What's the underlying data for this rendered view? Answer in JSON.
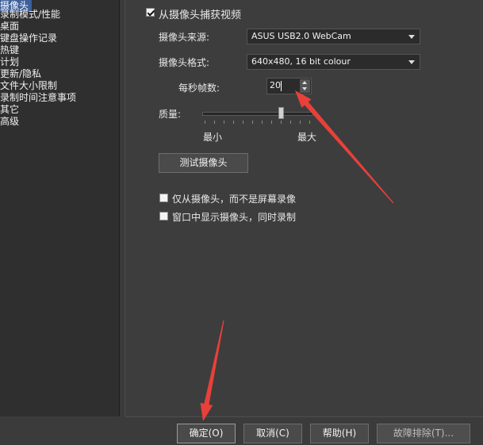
{
  "sidebar": {
    "items": [
      {
        "label": "摄像头",
        "selected": true
      },
      {
        "label": "录制模式/性能"
      },
      {
        "label": "桌面"
      },
      {
        "label": "键盘操作记录"
      },
      {
        "label": "热键"
      },
      {
        "label": "计划"
      },
      {
        "label": "更新/隐私"
      },
      {
        "label": "文件大小限制"
      },
      {
        "label": "录制时间注意事项"
      },
      {
        "label": "其它"
      },
      {
        "label": "高级"
      }
    ]
  },
  "webcam": {
    "capture_label": "从摄像头捕获视频",
    "capture_checked": true,
    "source_label": "摄像头来源:",
    "source_value": "ASUS USB2.0 WebCam",
    "format_label": "摄像头格式:",
    "format_value": "640x480, 16 bit colour",
    "fps_label": "每秒帧数:",
    "fps_value": "20",
    "quality_label": "质量:",
    "quality_min": "最小",
    "quality_max": "最大",
    "quality_level": 0.75,
    "test_button": "测试摄像头",
    "only_webcam_label": "仅从摄像头，而不是屏幕录像",
    "only_webcam_checked": false,
    "show_in_window_label": "窗口中显示摄像头，同时录制",
    "show_in_window_checked": false
  },
  "footer": {
    "ok": "确定(O)",
    "cancel": "取消(C)",
    "help": "帮助(H)",
    "troubleshoot": "故障排除(T)..."
  },
  "colors": {
    "annotation_arrow": "#e8403a",
    "selection": "#3d5f9a"
  }
}
